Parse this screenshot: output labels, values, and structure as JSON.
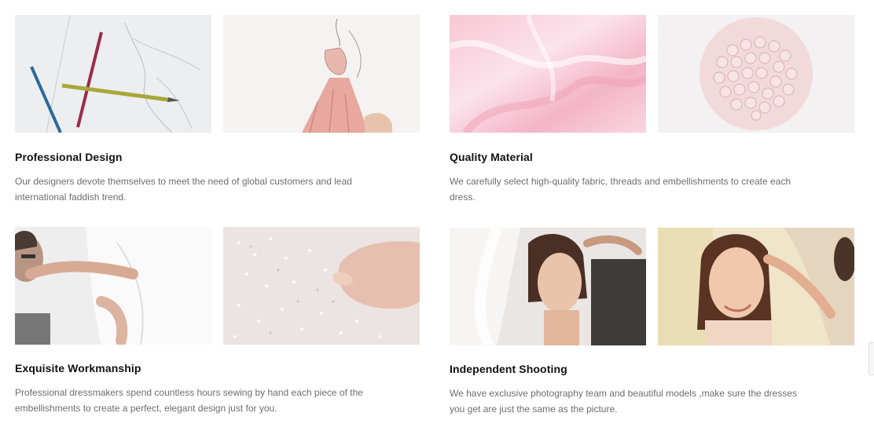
{
  "features": [
    {
      "title": "Professional Design",
      "description": "Our designers devote themselves to meet the need of global customers and lead international faddish trend.",
      "images": [
        "pencils-sketch-photo",
        "dress-sketch-photo"
      ]
    },
    {
      "title": "Quality Material",
      "description": "We carefully select high-quality fabric, threads and embellishments to create each dress.",
      "images": [
        "pink-satin-photo",
        "pearl-brooch-photo"
      ]
    },
    {
      "title": "Exquisite Workmanship",
      "description": "Professional dressmakers spend countless hours sewing by hand each piece of the embellishments to create a perfect, elegant design just for you.",
      "images": [
        "dress-fitting-photo",
        "hand-beading-photo"
      ]
    },
    {
      "title": "Independent Shooting",
      "description": "We have exclusive photography team and beautiful models ,make sure the dresses you get are just the same as the picture.",
      "images": [
        "model-veil-photo",
        "model-makeup-photo"
      ]
    }
  ],
  "colors": {
    "title": "#111111",
    "description": "#6d6d6d",
    "background": "#ffffff"
  }
}
